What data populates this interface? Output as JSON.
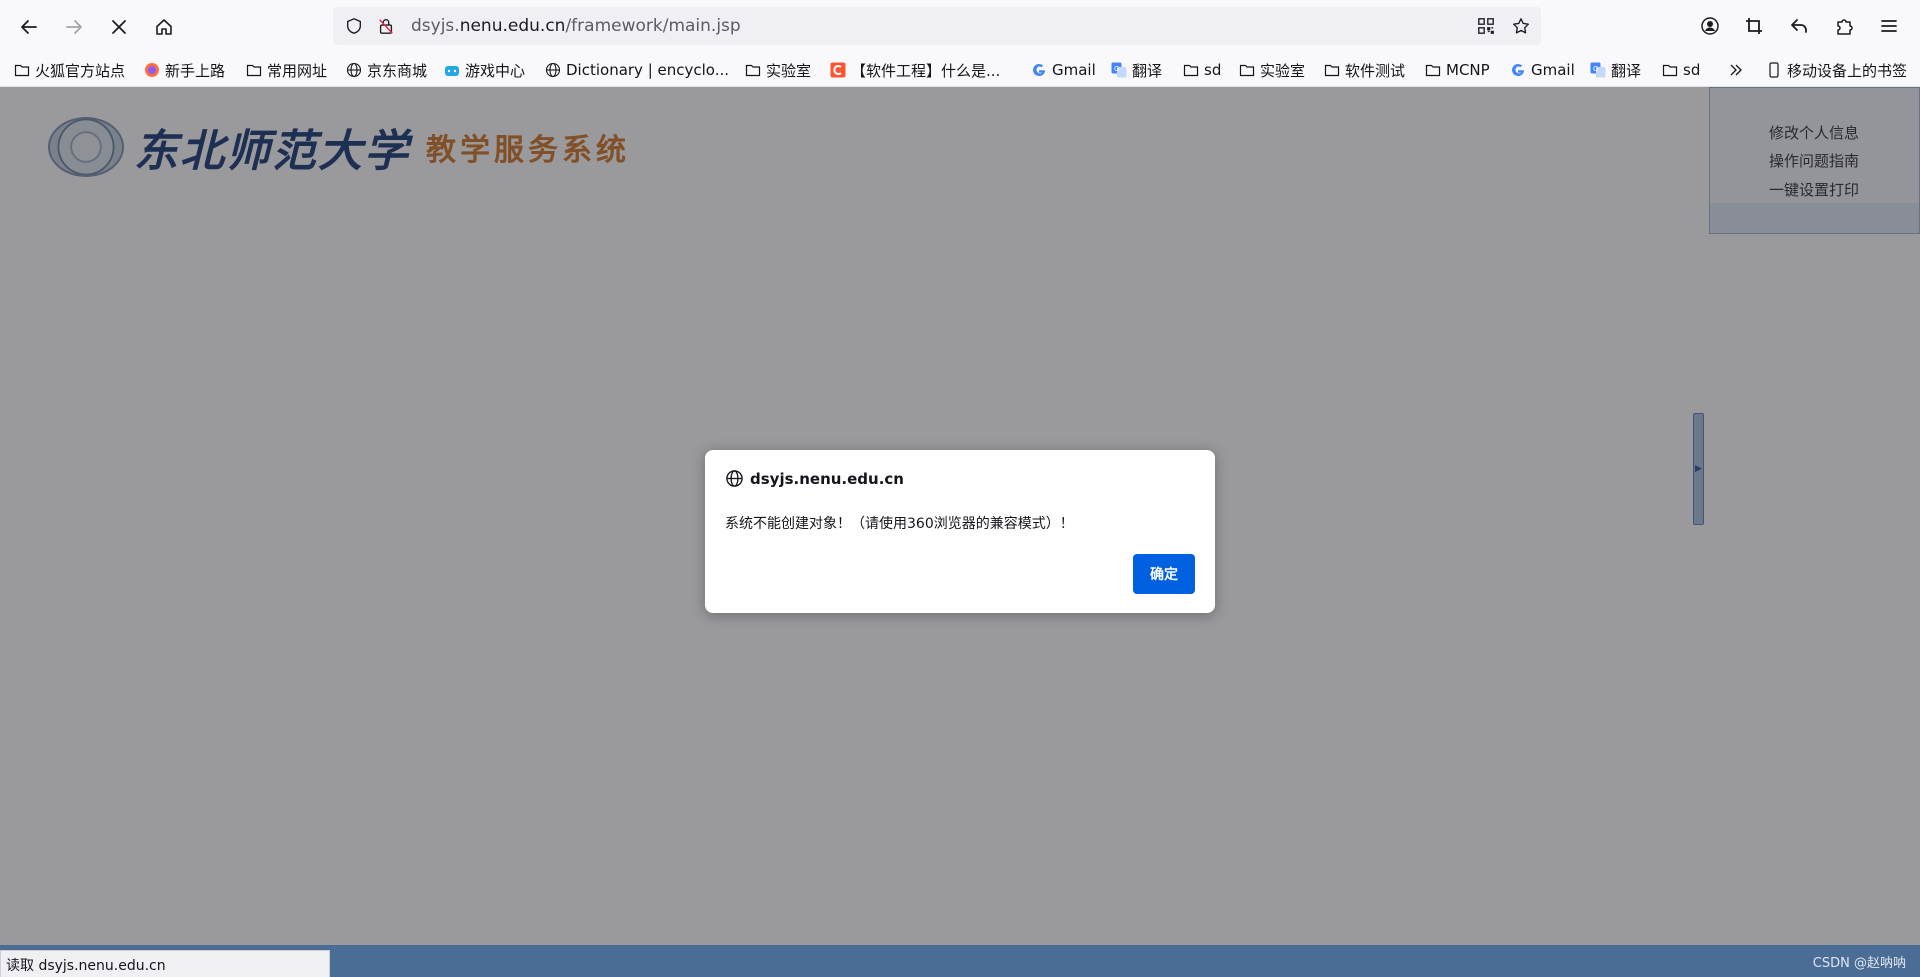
{
  "browser": {
    "url_prefix": "dsyjs.",
    "url_host": "nenu.edu.cn",
    "url_path": "/framework/main.jsp",
    "bookmarks": [
      {
        "label": "火狐官方站点",
        "icon": "folder-icon"
      },
      {
        "label": "新手上路",
        "icon": "firefox-icon"
      },
      {
        "label": "常用网址",
        "icon": "folder-icon"
      },
      {
        "label": "京东商城",
        "icon": "globe-icon"
      },
      {
        "label": "游戏中心",
        "icon": "game-icon"
      },
      {
        "label": "Dictionary | encyclo...",
        "icon": "globe-icon"
      },
      {
        "label": "实验室",
        "icon": "folder-icon"
      },
      {
        "label": "【软件工程】什么是...",
        "icon": "csdn-icon"
      },
      {
        "label": "Gmail",
        "icon": "google-icon"
      },
      {
        "label": "翻译",
        "icon": "translate-icon"
      },
      {
        "label": "sd",
        "icon": "folder-icon"
      },
      {
        "label": "实验室",
        "icon": "folder-icon"
      },
      {
        "label": "软件测试",
        "icon": "folder-icon"
      },
      {
        "label": "MCNP",
        "icon": "folder-icon"
      },
      {
        "label": "Gmail",
        "icon": "google-icon"
      },
      {
        "label": "翻译",
        "icon": "translate-icon"
      },
      {
        "label": "sd",
        "icon": "folder-icon"
      }
    ],
    "mobile_bookmarks": "移动设备上的书签",
    "status_text": "读取 dsyjs.nenu.edu.cn"
  },
  "page": {
    "logo_university": "东北师范大学",
    "logo_system": "教学服务系统",
    "user_links": [
      "修改个人信息",
      "操作问题指南",
      "一键设置打印"
    ]
  },
  "dialog": {
    "host": "dsyjs.nenu.edu.cn",
    "message": "系统不能创建对象！（请使用360浏览器的兼容模式）！",
    "ok_label": "确定"
  },
  "watermark": "CSDN @赵呐呐",
  "colors": {
    "accent": "#0061e0",
    "bottom_bar": "#4a6c95",
    "logo_blue": "#1d3f7a",
    "logo_orange": "#d4782d"
  }
}
